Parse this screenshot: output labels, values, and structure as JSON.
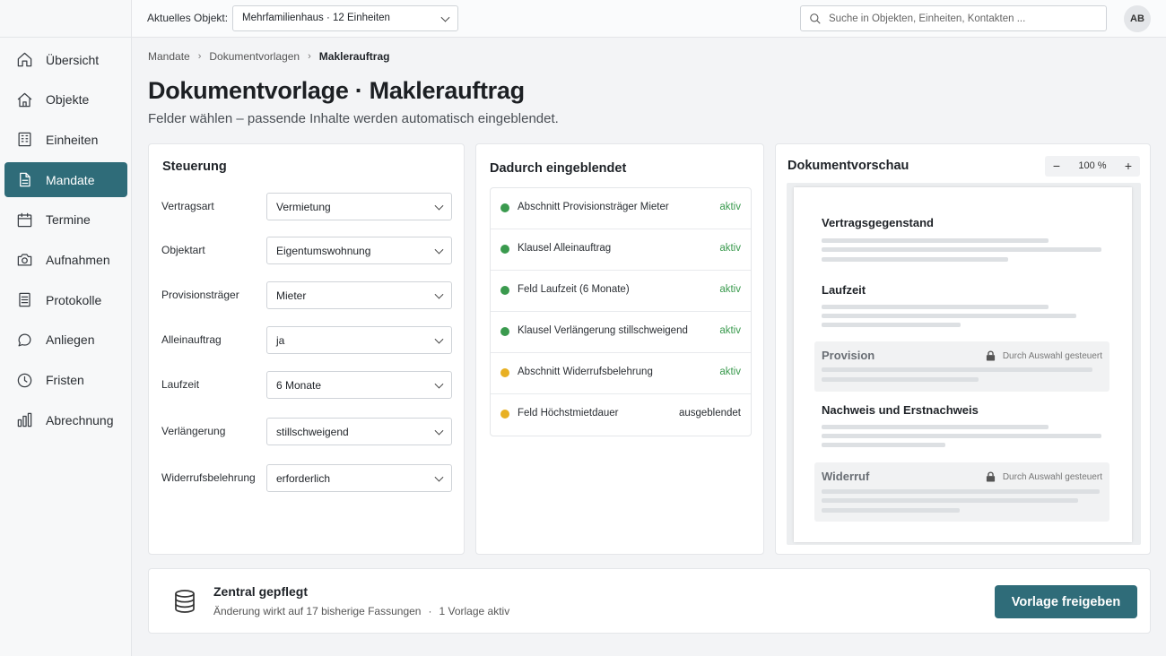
{
  "topbar": {
    "object_label": "Aktuelles Objekt:",
    "object_value": "Mehrfamilienhaus · 12 Einheiten",
    "search_placeholder": "Suche in Objekten, Einheiten, Kontakten ...",
    "avatar": "AB"
  },
  "sidebar": {
    "items": [
      {
        "label": "Übersicht",
        "icon": "home-icon",
        "active": false
      },
      {
        "label": "Objekte",
        "icon": "house-icon",
        "active": false
      },
      {
        "label": "Einheiten",
        "icon": "building-icon",
        "active": false
      },
      {
        "label": "Mandate",
        "icon": "document-icon",
        "active": true
      },
      {
        "label": "Termine",
        "icon": "calendar-icon",
        "active": false
      },
      {
        "label": "Aufnahmen",
        "icon": "camera-icon",
        "active": false
      },
      {
        "label": "Protokolle",
        "icon": "list-icon",
        "active": false
      },
      {
        "label": "Anliegen",
        "icon": "chat-icon",
        "active": false
      },
      {
        "label": "Fristen",
        "icon": "clock-icon",
        "active": false
      },
      {
        "label": "Abrechnung",
        "icon": "bar-chart-icon",
        "active": false
      }
    ]
  },
  "breadcrumb": [
    "Mandate",
    "Dokumentvorlagen",
    "Maklerauftrag"
  ],
  "page": {
    "title": "Dokumentvorlage · Maklerauftrag",
    "subtitle": "Felder wählen – passende Inhalte werden automatisch eingeblendet."
  },
  "controls": {
    "title": "Steuerung",
    "rows": [
      {
        "label": "Vertragsart",
        "value": "Vermietung"
      },
      {
        "label": "Objektart",
        "value": "Eigentumswohnung"
      },
      {
        "label": "Provisionsträger",
        "value": "Mieter"
      },
      {
        "label": "Alleinauftrag",
        "value": "ja"
      },
      {
        "label": "Laufzeit",
        "value": "6 Monate"
      },
      {
        "label": "Verlängerung",
        "value": "stillschweigend"
      },
      {
        "label": "Widerrufsbelehrung",
        "value": "erforderlich"
      }
    ]
  },
  "effects": {
    "title": "Dadurch eingeblendet",
    "items": [
      {
        "text": "Abschnitt Provisionsträger Mieter",
        "status": "aktiv",
        "dot": "#3a9a4e"
      },
      {
        "text": "Klausel Alleinauftrag",
        "status": "aktiv",
        "dot": "#3a9a4e"
      },
      {
        "text": "Feld Laufzeit (6 Monate)",
        "status": "aktiv",
        "dot": "#3a9a4e"
      },
      {
        "text": "Klausel Verlängerung stillschweigend",
        "status": "aktiv",
        "dot": "#3a9a4e"
      },
      {
        "text": "Abschnitt Widerrufsbelehrung",
        "status": "aktiv",
        "dot": "#e8b023"
      },
      {
        "text": "Feld Höchstmietdauer",
        "status": "ausgeblendet",
        "dot": "#e8b023"
      }
    ]
  },
  "preview": {
    "title": "Dokumentvorschau",
    "zoom_minus": "−",
    "zoom_value": "100 %",
    "zoom_plus": "+",
    "sections": {
      "s1": "Vertragsgegenstand",
      "s2": "Laufzeit",
      "s3": "Provision",
      "s4": "Nachweis und Erstnachweis",
      "s5": "Widerruf"
    },
    "locked_note": "Durch Auswahl gesteuert"
  },
  "footer": {
    "title": "Zentral gepflegt",
    "note1": "Änderung wirkt auf 17 bisherige Fassungen",
    "sep": "·",
    "note2": "1 Vorlage aktiv",
    "button": "Vorlage freigeben"
  },
  "colors": {
    "accent": "#2f6c79",
    "active_status": "#3a9a4e",
    "warning_dot": "#e8b023"
  }
}
